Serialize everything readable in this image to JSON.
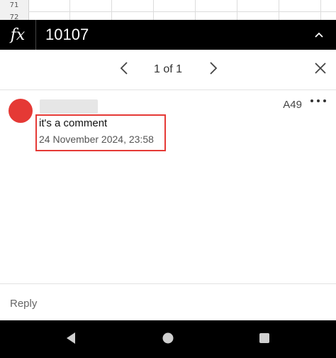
{
  "grid": {
    "rows": [
      "71",
      "72"
    ]
  },
  "formula_bar": {
    "fx_label": "fx",
    "value": "10107"
  },
  "navigation": {
    "page_indicator": "1 of 1"
  },
  "comment": {
    "cell_ref": "A49",
    "text": "it's a comment",
    "date": "24 November 2024, 23:58"
  },
  "reply": {
    "placeholder": "Reply"
  },
  "colors": {
    "avatar": "#e53935",
    "highlight": "#e53935",
    "formula_bg": "#000000",
    "system_bar": "#000000"
  }
}
